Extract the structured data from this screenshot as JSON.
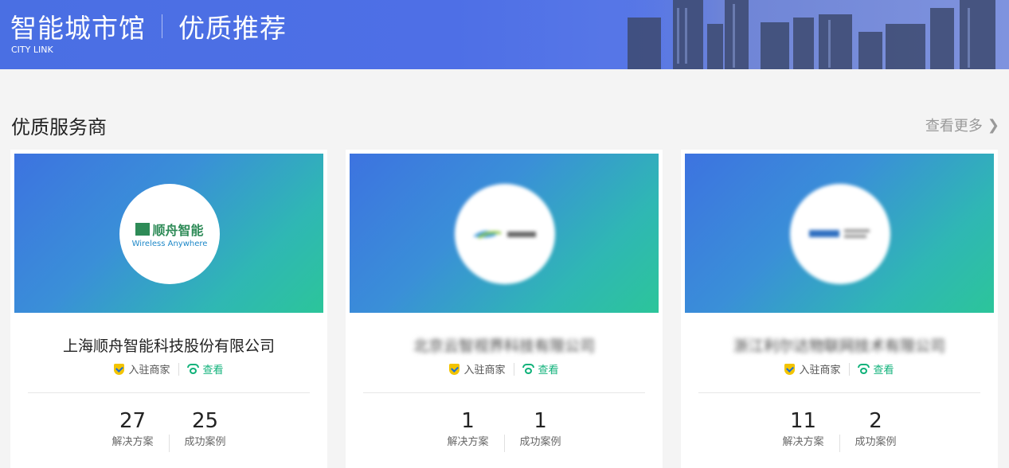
{
  "banner": {
    "title_left": "智能城市馆",
    "title_right": "优质推荐",
    "subtitle": "CITY LINK"
  },
  "section": {
    "title": "优质服务商",
    "more_label": "查看更多",
    "more_icon": "chevron-right-icon"
  },
  "cards": [
    {
      "logo": {
        "cn": "顺舟智能",
        "en": "Wireless Anywhere"
      },
      "name": "上海顺舟智能科技股份有限公司",
      "tag_settled": "入驻商家",
      "tag_view": "查看",
      "solutions": "27",
      "solutions_label": "解决方案",
      "cases": "25",
      "cases_label": "成功案例"
    },
    {
      "logo": {
        "cn": "",
        "en": ""
      },
      "name": "北京云智视界科技有限公司",
      "tag_settled": "入驻商家",
      "tag_view": "查看",
      "solutions": "1",
      "solutions_label": "解决方案",
      "cases": "1",
      "cases_label": "成功案例"
    },
    {
      "logo": {
        "cn": "",
        "en": ""
      },
      "name": "浙江利尔达物联网技术有限公司",
      "tag_settled": "入驻商家",
      "tag_view": "查看",
      "solutions": "11",
      "solutions_label": "解决方案",
      "cases": "2",
      "cases_label": "成功案例"
    }
  ],
  "colors": {
    "banner": "#4e6fe6",
    "accent_green": "#10b27a",
    "badge_yellow": "#f3c400"
  }
}
